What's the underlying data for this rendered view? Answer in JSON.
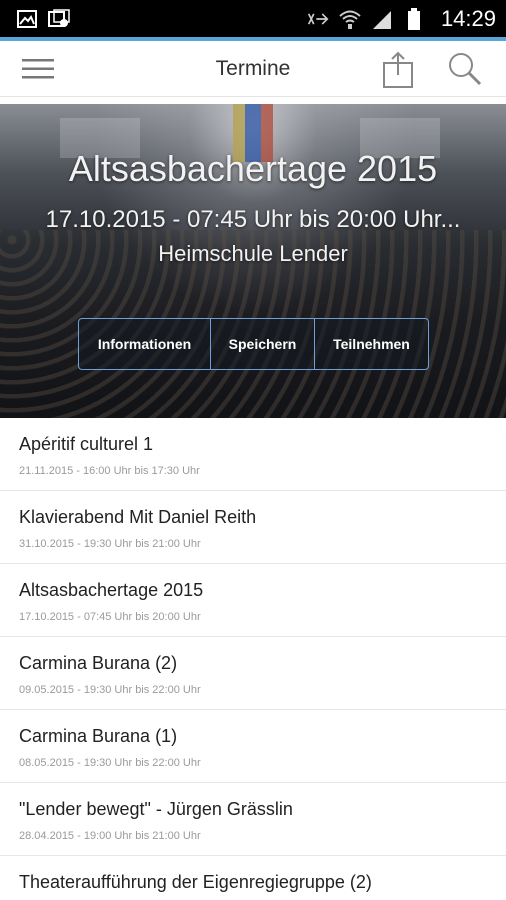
{
  "status_bar": {
    "time": "14:29",
    "left_icons": [
      "image-icon",
      "photo-gallery-icon"
    ],
    "right_icons": [
      "nfc-icon",
      "wifi-icon",
      "signal-icon",
      "battery-icon"
    ]
  },
  "app_bar": {
    "title": "Termine",
    "icons": [
      "menu-icon",
      "share-icon",
      "search-icon"
    ]
  },
  "hero": {
    "title": "Altsasbachertage 2015",
    "datetime": "17.10.2015 - 07:45 Uhr bis 20:00 Uhr...",
    "location": "Heimschule Lender",
    "actions": [
      {
        "label": "Informationen"
      },
      {
        "label": "Speichern"
      },
      {
        "label": "Teilnehmen"
      }
    ]
  },
  "events": [
    {
      "title": "Apéritif culturel 1",
      "time": "21.11.2015 - 16:00 Uhr bis 17:30 Uhr"
    },
    {
      "title": "Klavierabend Mit Daniel Reith",
      "time": "31.10.2015 - 19:30 Uhr bis 21:00 Uhr"
    },
    {
      "title": "Altsasbachertage 2015",
      "time": "17.10.2015 - 07:45 Uhr bis 20:00 Uhr"
    },
    {
      "title": "Carmina Burana (2)",
      "time": "09.05.2015 - 19:30 Uhr bis 22:00 Uhr"
    },
    {
      "title": "Carmina Burana (1)",
      "time": "08.05.2015 - 19:30 Uhr bis 22:00 Uhr"
    },
    {
      "title": "\"Lender bewegt\" - Jürgen Grässlin",
      "time": "28.04.2015 - 19:00 Uhr bis 21:00 Uhr"
    },
    {
      "title": "Theateraufführung der Eigenregiegruppe (2)",
      "time": ""
    }
  ],
  "colors": {
    "accent_line": "#58a6d8",
    "hero_button_border": "#6f9fd6",
    "status_bar": "#000000"
  }
}
